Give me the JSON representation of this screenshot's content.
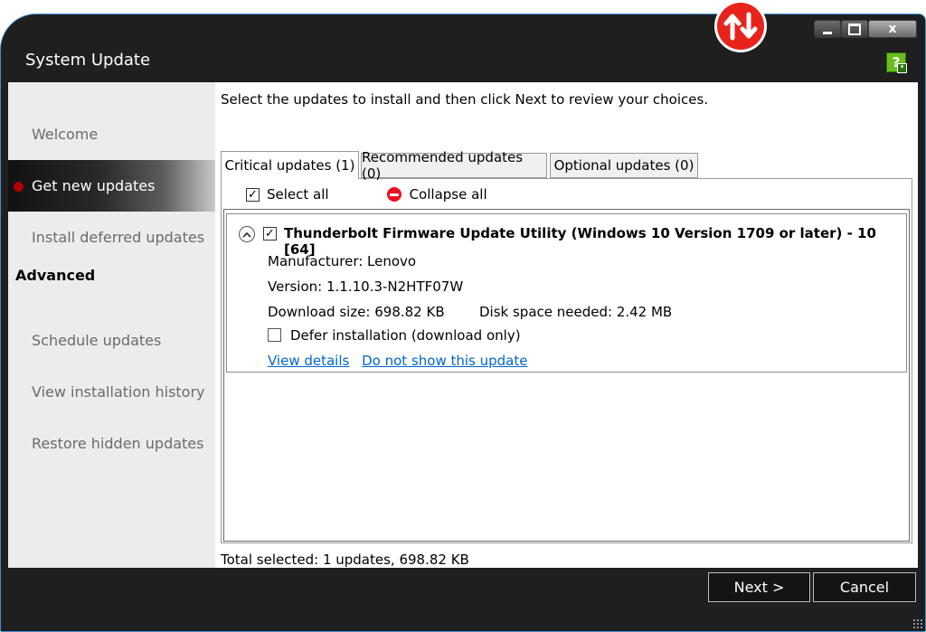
{
  "window": {
    "title": "System Update",
    "close_glyph": "x"
  },
  "sidebar": {
    "items": [
      {
        "label": "Welcome"
      },
      {
        "label": "Get new updates"
      },
      {
        "label": "Install deferred updates"
      },
      {
        "label": "Schedule updates"
      },
      {
        "label": "View installation history"
      },
      {
        "label": "Restore hidden updates"
      }
    ],
    "advanced_label": "Advanced"
  },
  "main": {
    "instructions": "Select the updates to install and then click Next to review your choices.",
    "tabs": [
      {
        "label": "Critical updates (1)"
      },
      {
        "label": "Recommended updates (0)"
      },
      {
        "label": "Optional updates (0)"
      }
    ],
    "select_all_label": "Select all",
    "collapse_all_label": "Collapse all",
    "update": {
      "title": "Thunderbolt Firmware Update Utility (Windows 10 Version 1709 or later) - 10 [64]",
      "manufacturer": "Manufacturer: Lenovo",
      "version": "Version: 1.1.10.3-N2HTF07W",
      "download_size": "Download size:  698.82 KB",
      "disk_space": "Disk space needed:  2.42 MB",
      "defer_label": "Defer installation (download only)",
      "view_details_link": "View details",
      "hide_update_link": "Do not show this update"
    },
    "total_selected": "Total selected: 1 updates,  698.82 KB"
  },
  "buttons": {
    "next": "Next >",
    "cancel": "Cancel"
  },
  "help_icon_text": "?",
  "colors": {
    "chrome": "#1f1f1f",
    "accent_red": "#e81123",
    "active_dot": "#b00000",
    "link": "#0066cc",
    "help_green": "#6abf1e"
  }
}
